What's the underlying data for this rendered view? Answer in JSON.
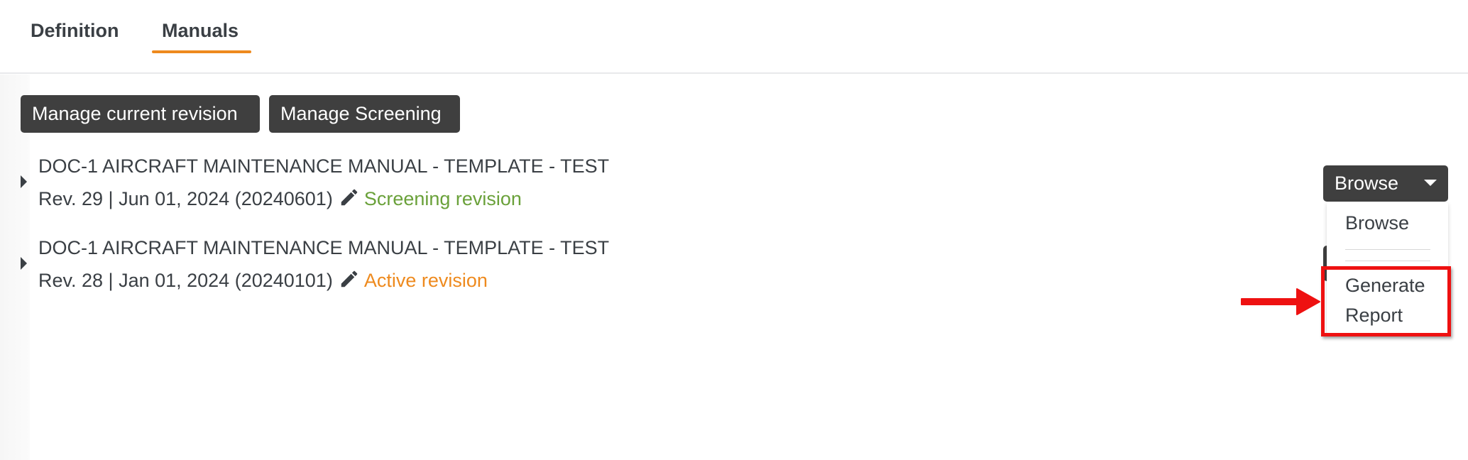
{
  "tabs": [
    {
      "label": "Definition",
      "active": false
    },
    {
      "label": "Manuals",
      "active": true
    }
  ],
  "actions": {
    "manage_revision": "Manage current revision",
    "manage_screening": "Manage Screening"
  },
  "manuals": [
    {
      "title": "DOC-1 AIRCRAFT MAINTENANCE MANUAL - TEMPLATE - TEST",
      "meta": "Rev. 29 | Jun 01, 2024 (20240601)",
      "status": "Screening revision",
      "status_color": "#6aa13a",
      "edit_icon": "pencil-icon"
    },
    {
      "title": "DOC-1 AIRCRAFT MAINTENANCE MANUAL - TEMPLATE - TEST",
      "meta": "Rev. 28 | Jan 01, 2024 (20240101)",
      "status": "Active revision",
      "status_color": "#ee8a1e",
      "edit_icon": "pencil-icon"
    }
  ],
  "browse_dropdown": {
    "button_label": "Browse",
    "items": [
      "Browse",
      "Generate Report"
    ]
  },
  "colors": {
    "accent": "#ee8a1e",
    "button_dark": "#3f3f3f",
    "annotation_red": "#ee1111"
  }
}
